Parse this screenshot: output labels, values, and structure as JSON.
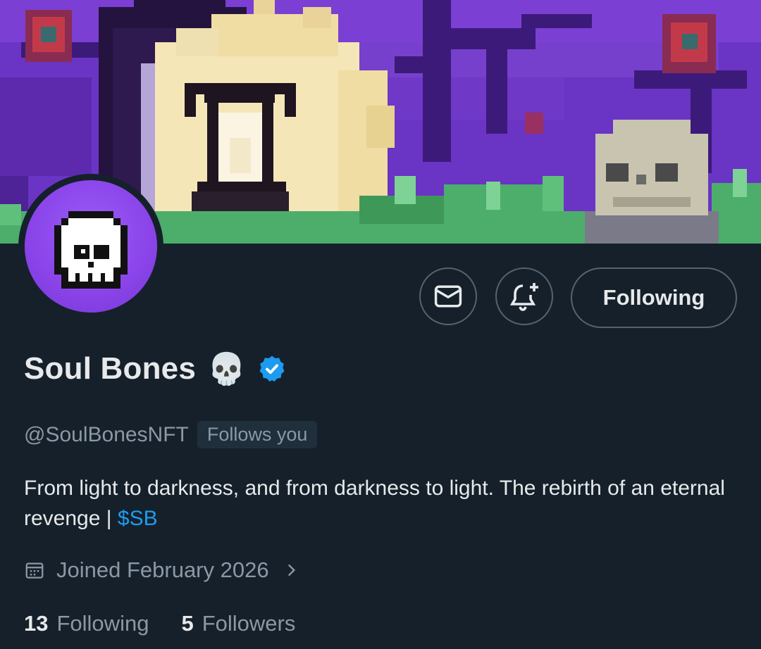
{
  "profile": {
    "display_name": "Soul Bones",
    "name_emoji": "💀",
    "handle": "@SoulBonesNFT",
    "follows_you": "Follows you",
    "bio_text": "From light to darkness, and from darkness to light. The rebirth of an eternal revenge | ",
    "bio_link": "$SB",
    "joined": "Joined February 2026",
    "following_count": "13",
    "following_label": "Following",
    "followers_count": "5",
    "followers_label": "Followers"
  },
  "actions": {
    "message_icon": "envelope-icon",
    "notify_icon": "bell-plus-icon",
    "follow_button": "Following"
  },
  "colors": {
    "background": "#15202b",
    "accent": "#1d9bf0",
    "muted_text": "#8b98a5",
    "verified": "#1d9bf0",
    "avatar_bg": "#8b45ea"
  }
}
